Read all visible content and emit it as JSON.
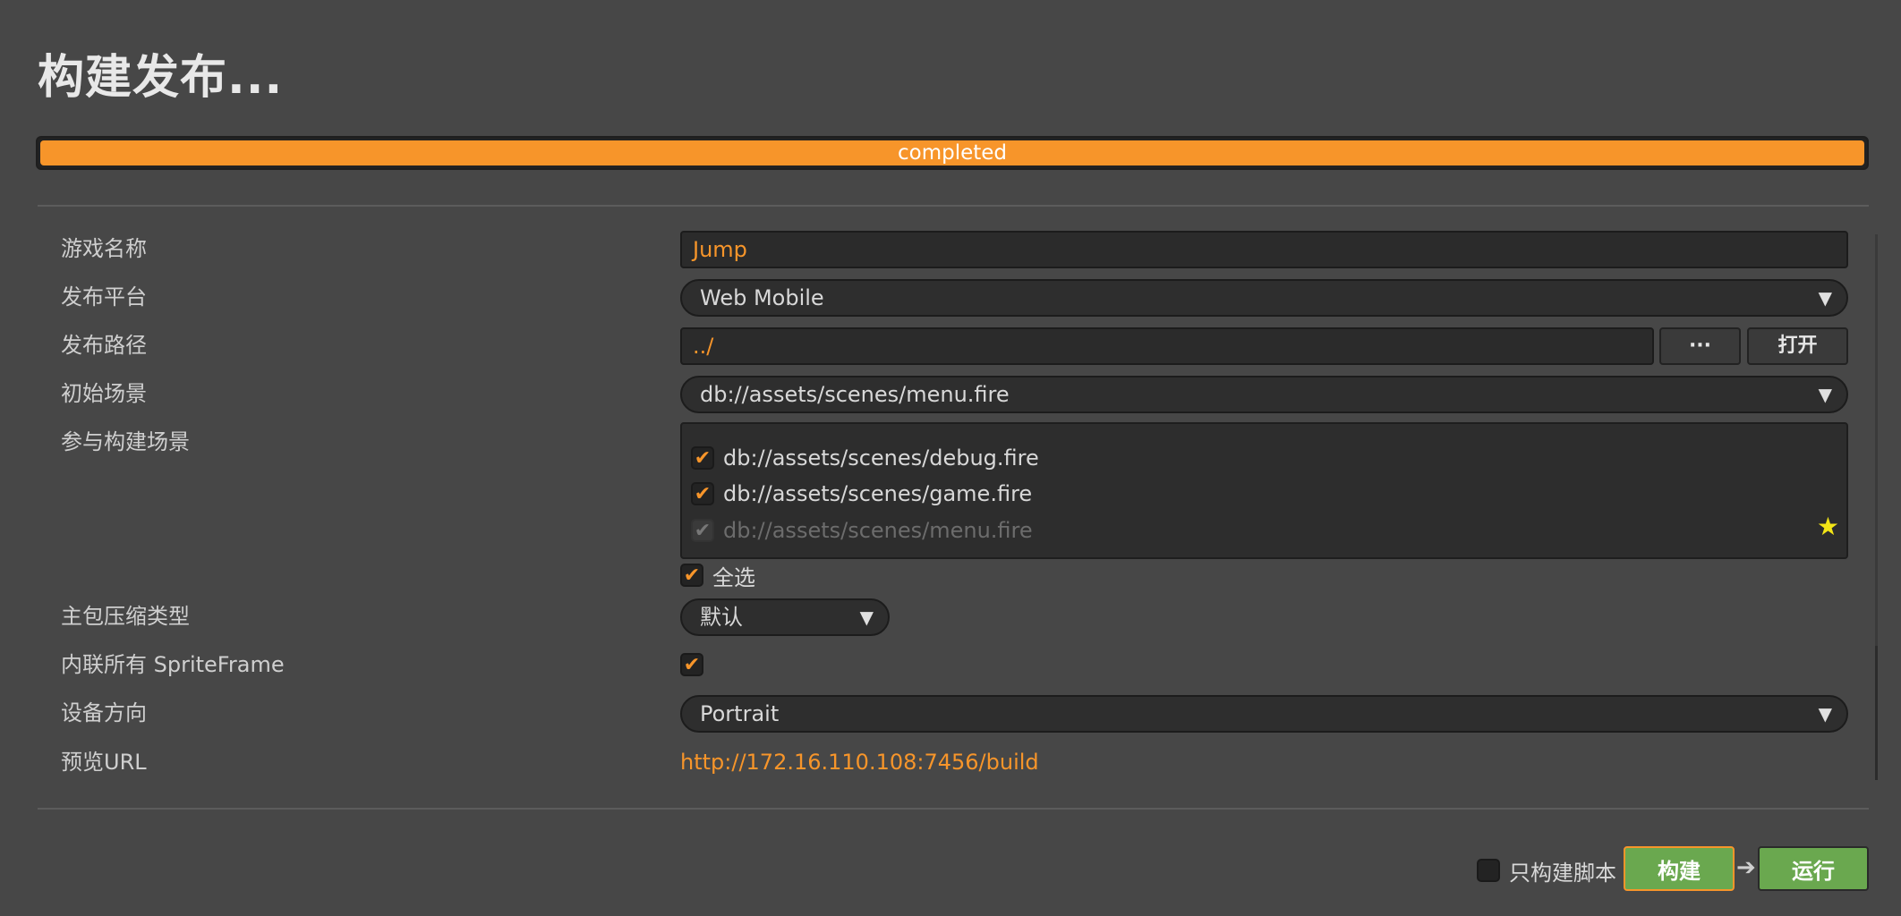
{
  "title": "构建发布...",
  "progress": {
    "label": "completed",
    "fraction": 1.0
  },
  "form": {
    "game_name": {
      "label": "游戏名称",
      "value": "Jump"
    },
    "platform": {
      "label": "发布平台",
      "value": "Web Mobile"
    },
    "build_path": {
      "label": "发布路径",
      "value": "../",
      "browse_label": "···",
      "open_label": "打开"
    },
    "start_scene": {
      "label": "初始场景",
      "value": "db://assets/scenes/menu.fire"
    },
    "scenes": {
      "label": "参与构建场景",
      "items": [
        {
          "path": "db://assets/scenes/debug.fire",
          "checked": true,
          "disabled": false
        },
        {
          "path": "db://assets/scenes/game.fire",
          "checked": true,
          "disabled": false
        },
        {
          "path": "db://assets/scenes/menu.fire",
          "checked": true,
          "disabled": true
        }
      ],
      "select_all_label": "全选",
      "check_mark": "✔",
      "star_icon": "★"
    },
    "compression": {
      "label": "主包压缩类型",
      "value": "默认"
    },
    "inline_spriteframe": {
      "label": "内联所有 SpriteFrame",
      "checked": true
    },
    "orientation": {
      "label": "设备方向",
      "value": "Portrait"
    },
    "preview_url": {
      "label": "预览URL",
      "value": "http://172.16.110.108:7456/build"
    }
  },
  "footer": {
    "script_only_label": "只构建脚本",
    "script_only_checked": false,
    "build_label": "构建",
    "arrow": "➔",
    "run_label": "运行"
  },
  "dropdown_arrow": "▼",
  "colors": {
    "accent": "#f7952a",
    "button_green": "#6aa84f",
    "background": "#474747",
    "star": "#f3e516"
  }
}
